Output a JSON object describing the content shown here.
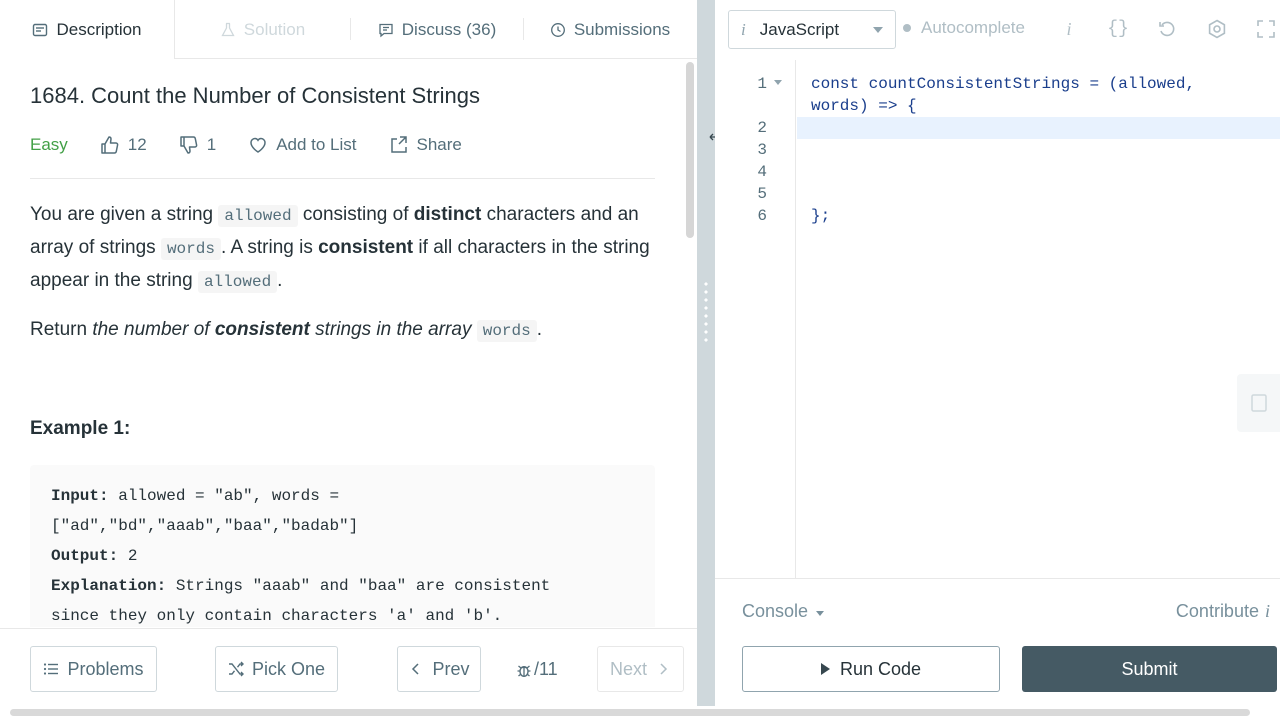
{
  "tabs": {
    "description": "Description",
    "solution": "Solution",
    "discuss": "Discuss (36)",
    "submissions": "Submissions"
  },
  "problem": {
    "title": "1684. Count the Number of Consistent Strings",
    "difficulty": "Easy",
    "likes": "12",
    "dislikes": "1",
    "add_to_list": "Add to List",
    "share": "Share",
    "p1": {
      "t1": "You are given a string ",
      "c1": "allowed",
      "t2": " consisting of ",
      "b1": "distinct",
      "t3": " characters and an array of strings ",
      "c2": "words",
      "t4": ". A string is ",
      "b2": "consistent",
      "t5": " if all characters in the string appear in the string ",
      "c3": "allowed",
      "t6": "."
    },
    "p2": {
      "t1": "Return ",
      "i1": "the number of ",
      "b1": "consistent",
      "i2": " strings in the array ",
      "c1": "words",
      "t2": "."
    },
    "example_title": "Example 1:",
    "example": {
      "input_label": "Input:",
      "input_value": " allowed = \"ab\", words =",
      "input_value2": "[\"ad\",\"bd\",\"aaab\",\"baa\",\"badab\"]",
      "output_label": "Output:",
      "output_value": " 2",
      "explanation_label": "Explanation:",
      "explanation_value": " Strings \"aaab\" and \"baa\" are consistent",
      "explanation_value2": "since they only contain characters 'a' and 'b'."
    }
  },
  "bottom": {
    "problems": "Problems",
    "pick_one": "Pick One",
    "prev": "Prev",
    "page": "/11",
    "next": "Next"
  },
  "editor": {
    "language": "JavaScript",
    "language_info": "i",
    "autocomplete": "Autocomplete",
    "info_icon": "i",
    "braces": "{}",
    "lines": [
      "1",
      "2",
      "3",
      "4",
      "5",
      "6"
    ],
    "code_line1": "const countConsistentStrings = (allowed,",
    "code_line1b": "words) => {",
    "code_line6": "};"
  },
  "console": {
    "console_label": "Console",
    "contribute": "Contribute",
    "contribute_info": "i",
    "run_code": "Run Code",
    "submit": "Submit"
  },
  "colors": {
    "easy": "#43a047",
    "submit_bg": "#455a64",
    "divider": "#cfd8dc",
    "code_blue": "#1a3e8c"
  }
}
